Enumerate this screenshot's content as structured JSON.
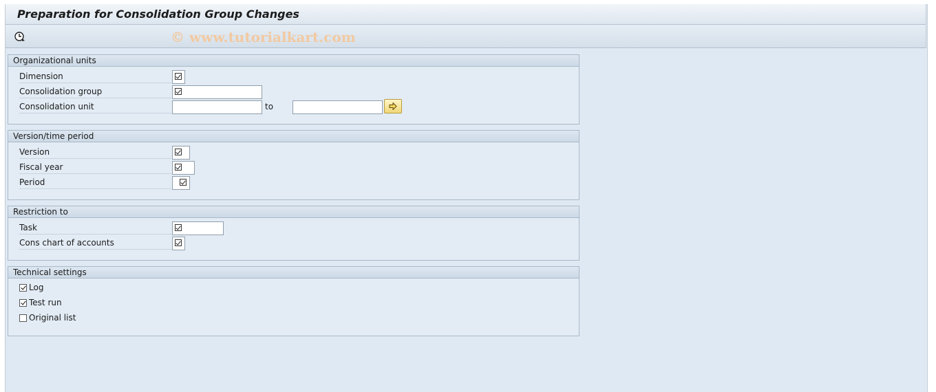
{
  "title": "Preparation for Consolidation Group Changes",
  "toolbar": {
    "execute_icon": "execute-clock-icon"
  },
  "watermark": "© www.tutorialkart.com",
  "org_units": {
    "header": "Organizational units",
    "dimension_label": "Dimension",
    "dimension_value": "",
    "cons_group_label": "Consolidation group",
    "cons_group_value": "",
    "cons_unit_label": "Consolidation unit",
    "cons_unit_from": "",
    "to_label": "to",
    "cons_unit_to": ""
  },
  "version_period": {
    "header": "Version/time period",
    "version_label": "Version",
    "version_value": "",
    "fiscal_year_label": "Fiscal year",
    "fiscal_year_value": "",
    "period_label": "Period",
    "period_value": ""
  },
  "restriction": {
    "header": "Restriction to",
    "task_label": "Task",
    "task_value": "",
    "coa_label": "Cons chart of accounts",
    "coa_value": ""
  },
  "technical": {
    "header": "Technical settings",
    "log_label": "Log",
    "log_checked": true,
    "test_run_label": "Test run",
    "test_run_checked": true,
    "original_list_label": "Original list",
    "original_list_checked": false
  }
}
